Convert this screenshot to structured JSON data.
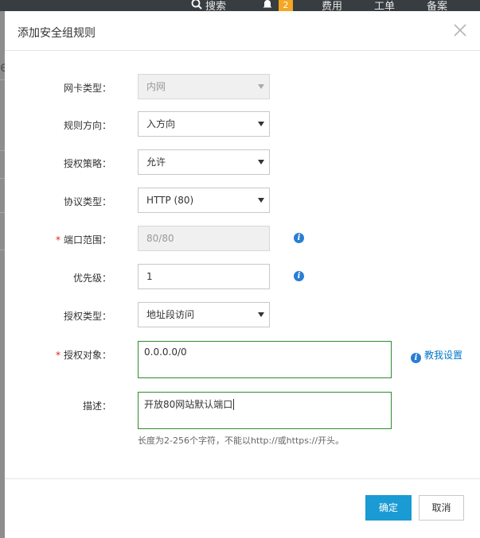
{
  "topbar": {
    "search_label": "搜索",
    "notification_count": "2",
    "items": [
      "费用",
      "工单",
      "备案"
    ]
  },
  "dialog": {
    "title": "添加安全组规则",
    "close_icon": "close-icon",
    "fields": {
      "nic_type": {
        "label": "网卡类型：",
        "value": "内网",
        "disabled": true
      },
      "rule_direction": {
        "label": "规则方向：",
        "value": "入方向"
      },
      "policy": {
        "label": "授权策略：",
        "value": "允许"
      },
      "protocol": {
        "label": "协议类型：",
        "value": "HTTP (80)"
      },
      "port_range": {
        "label": "端口范围：",
        "value": "80/80",
        "required": true,
        "disabled": true
      },
      "priority": {
        "label": "优先级：",
        "value": "1"
      },
      "auth_type": {
        "label": "授权类型：",
        "value": "地址段访问"
      },
      "auth_object": {
        "label": "授权对象：",
        "value": "0.0.0.0/0",
        "required": true
      },
      "description": {
        "label": "描述：",
        "value": "开放80网站默认端口"
      }
    },
    "required_mark": "*",
    "help_link": "教我设置",
    "description_hint": "长度为2-256个字符，不能以http://或https://开头。",
    "ok_label": "确定",
    "cancel_label": "取消"
  },
  "colors": {
    "primary": "#1a9bd3",
    "info_icon": "#2a7ed3",
    "link": "#0077cc",
    "required": "#e2231a",
    "textarea_border": "#2e8b2e",
    "badge": "#f5a623"
  }
}
